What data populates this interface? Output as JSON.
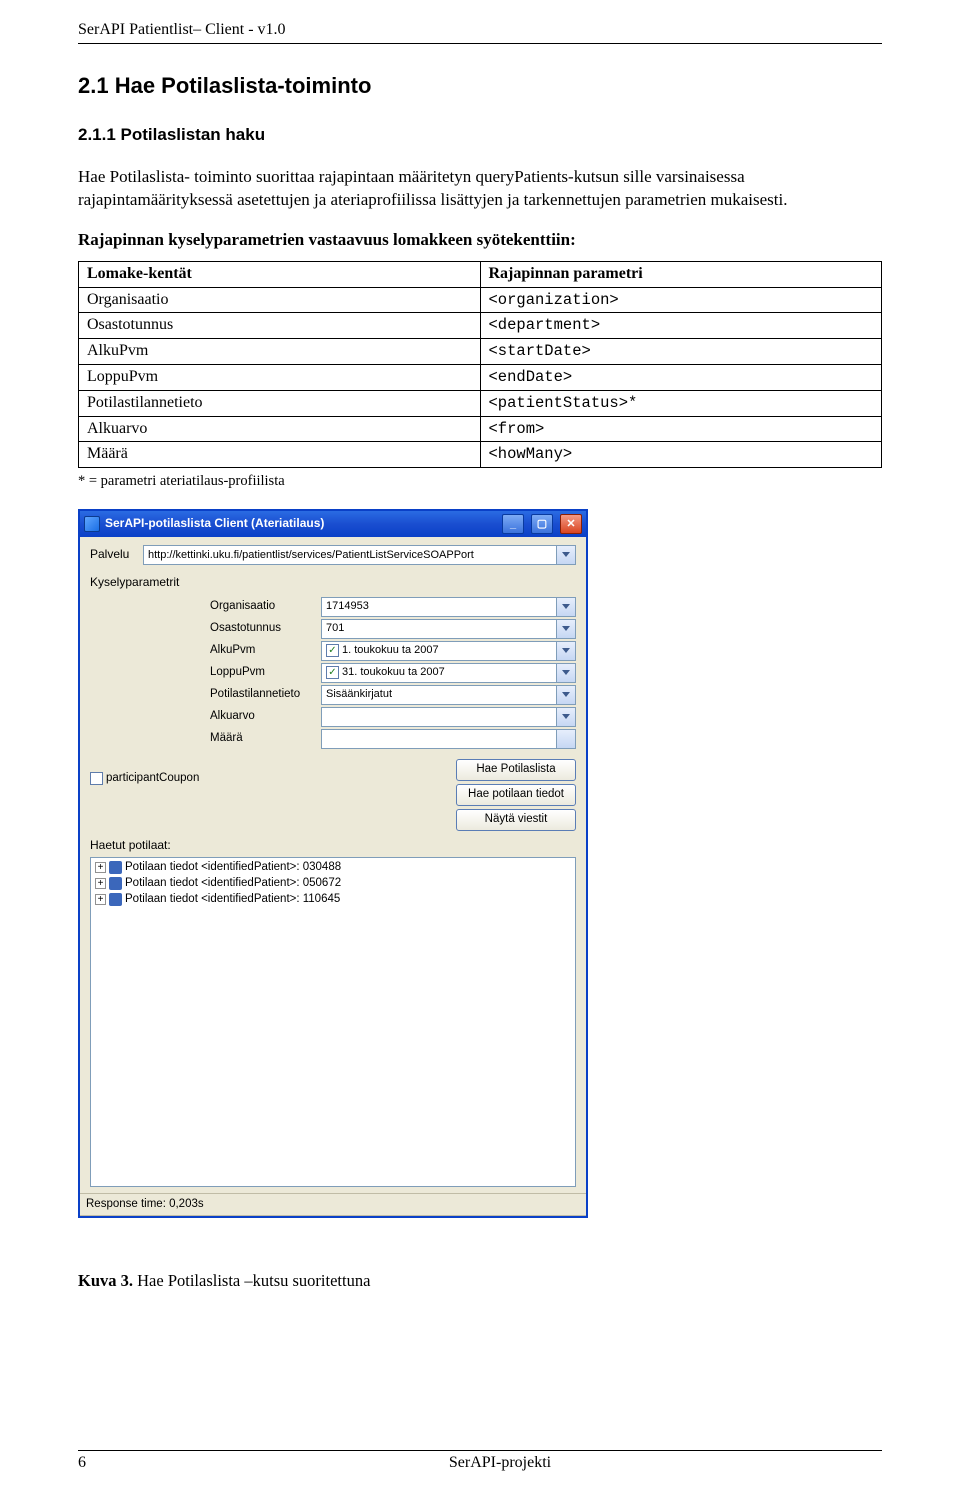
{
  "header": "SerAPI Patientlist– Client -  v1.0",
  "h2": "2.1  Hae Potilaslista-toiminto",
  "h3": "2.1.1   Potilaslistan haku",
  "para": "Hae Potilaslista- toiminto suorittaa rajapintaan määritetyn queryPatients-kutsun sille varsinaisessa rajapintamäärityksessä asetettujen ja ateriaprofiilissa lisättyjen ja tarkennettujen parametrien mukaisesti.",
  "boldLine": "Rajapinnan kyselyparametrien vastaavuus lomakkeen syötekenttiin:",
  "table": {
    "headers": [
      "Lomake-kentät",
      "Rajapinnan parametri"
    ],
    "rows": [
      {
        "field": "Organisaatio",
        "param": "<organization>"
      },
      {
        "field": "Osastotunnus",
        "param": "<department>"
      },
      {
        "field": "AlkuPvm",
        "param": "<startDate>"
      },
      {
        "field": "LoppuPvm",
        "param": "<endDate>"
      },
      {
        "field": "Potilastilannetieto",
        "param": "<patientStatus>*"
      },
      {
        "field": "Alkuarvo",
        "param": "<from>"
      },
      {
        "field": "Määrä",
        "param": "<howMany>"
      }
    ]
  },
  "footnote": "* =   parametri ateriatilaus-profiilista",
  "dialog": {
    "title": "SerAPI-potilaslista Client (Ateriatilaus)",
    "palveluLabel": "Palvelu",
    "palveluValue": "http://kettinki.uku.fi/patientlist/services/PatientListServiceSOAPPort",
    "kyselyHeader": "Kyselyparametrit",
    "fields": [
      {
        "label": "Organisaatio",
        "value": "1714953",
        "check": false
      },
      {
        "label": "Osastotunnus",
        "value": "701",
        "check": false
      },
      {
        "label": "AlkuPvm",
        "value": "1.  toukokuu ta 2007",
        "check": true
      },
      {
        "label": "LoppuPvm",
        "value": "31.  toukokuu ta 2007",
        "check": true
      },
      {
        "label": "Potilastilannetieto",
        "value": "Sisäänkirjatut",
        "check": false
      },
      {
        "label": "Alkuarvo",
        "value": "",
        "check": false
      },
      {
        "label": "Määrä",
        "value": "",
        "check": false
      }
    ],
    "participantCoupon": "participantCoupon",
    "buttons": [
      "Hae Potilaslista",
      "Hae potilaan tiedot",
      "Näytä viestit"
    ],
    "haetut": "Haetut potilaat:",
    "treeItems": [
      "Potilaan tiedot <identifiedPatient>: 030488",
      "Potilaan tiedot <identifiedPatient>: 050672",
      "Potilaan tiedot <identifiedPatient>: 110645"
    ],
    "status": "Response time: 0,203s"
  },
  "caption": {
    "label": "Kuva 3.",
    "text": " Hae Potilaslista –kutsu suoritettuna"
  },
  "footer": {
    "page": "6",
    "project": "SerAPI-projekti"
  }
}
